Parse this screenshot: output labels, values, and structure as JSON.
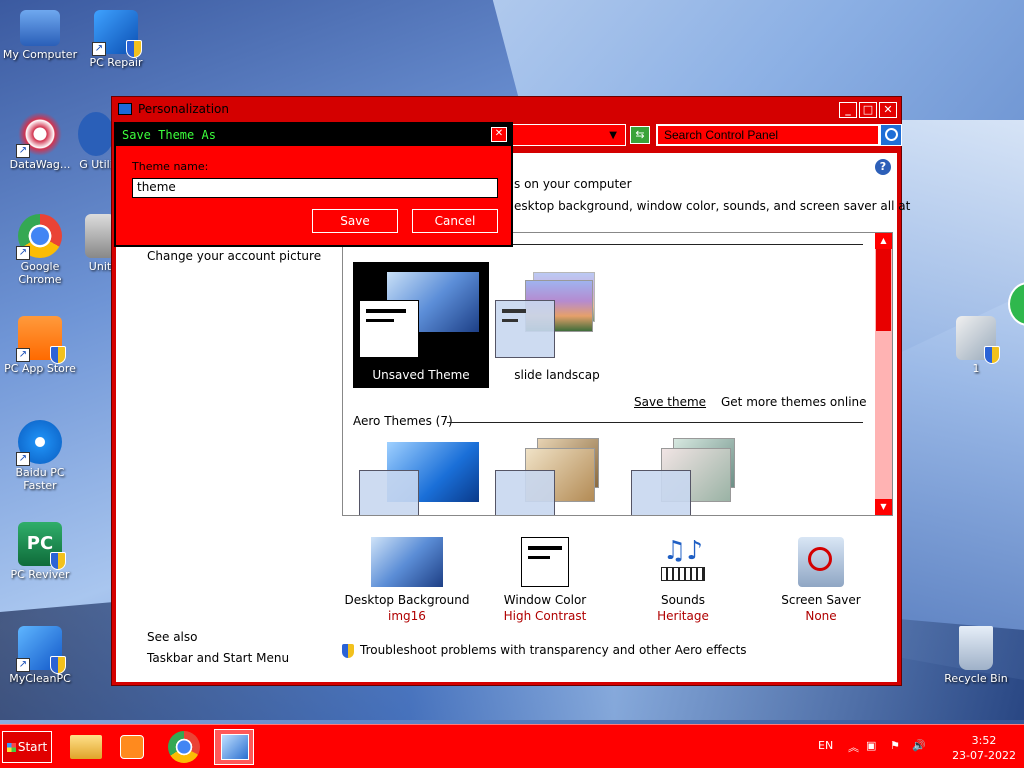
{
  "desktop": {
    "icons": [
      {
        "label": "My Computer"
      },
      {
        "label": "PC Repair"
      },
      {
        "label": "DataWag..."
      },
      {
        "label": "G Utili"
      },
      {
        "label": "Google Chrome"
      },
      {
        "label": "Unit"
      },
      {
        "label": "PC App Store"
      },
      {
        "label": "Baidu PC Faster"
      },
      {
        "label": "PC Reviver"
      },
      {
        "label": "MyCleanPC"
      },
      {
        "label": "1"
      },
      {
        "label": "Recycle Bin"
      }
    ]
  },
  "window": {
    "title": "Personalization",
    "search_placeholder": "Search Control Panel",
    "heading": "s on your computer",
    "subheading": "esktop background, window color, sounds, and screen saver all at",
    "side_links": [
      "Change your account picture"
    ],
    "theme_groups": {
      "my_themes": {
        "tiles": [
          "Unsaved Theme",
          "slide landscap"
        ],
        "save_link": "Save theme",
        "more_link": "Get more themes online"
      },
      "aero": {
        "label": "Aero Themes (7)"
      }
    },
    "bottom_items": [
      {
        "title": "Desktop Background",
        "value": "img16"
      },
      {
        "title": "Window Color",
        "value": "High Contrast"
      },
      {
        "title": "Sounds",
        "value": "Heritage"
      },
      {
        "title": "Screen Saver",
        "value": "None"
      }
    ],
    "see_also": {
      "heading": "See also",
      "links": [
        "Taskbar and Start Menu"
      ]
    },
    "troubleshoot": "Troubleshoot problems with transparency and other Aero effects"
  },
  "dialog": {
    "title": "Save Theme As",
    "label": "Theme name:",
    "value": "theme",
    "save": "Save",
    "cancel": "Cancel"
  },
  "taskbar": {
    "start": "Start",
    "lang": "EN",
    "time": "3:52",
    "date": "23-07-2022"
  },
  "colors": {
    "window": "#d40000",
    "taskbar": "#ff0000",
    "dialog_title_text": "#3cff3c",
    "value_text": "#b00000"
  }
}
